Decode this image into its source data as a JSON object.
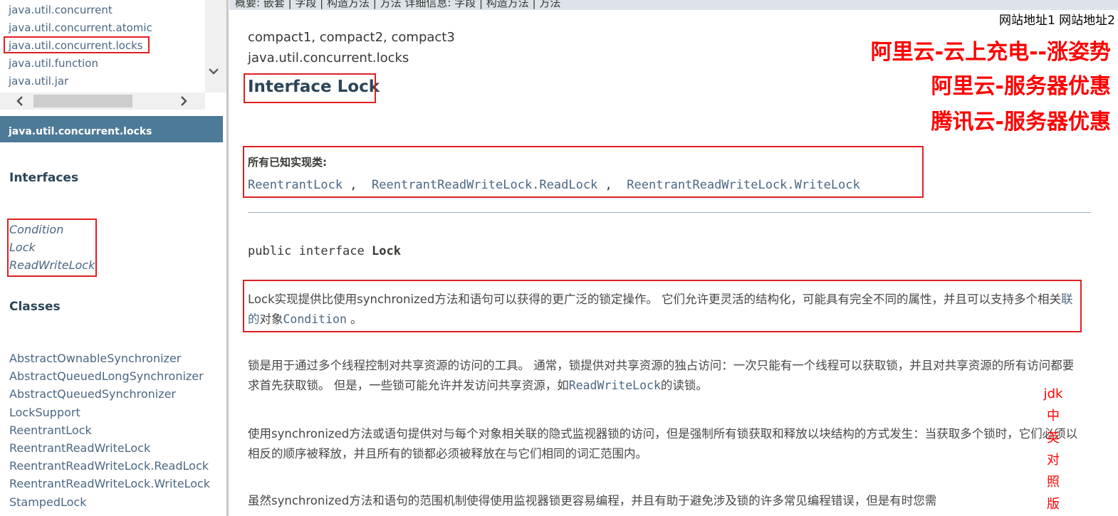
{
  "package_frame": {
    "packages": [
      "java.util.concurrent",
      "java.util.concurrent.atomic",
      "java.util.concurrent.locks",
      "java.util.function",
      "java.util.jar"
    ]
  },
  "class_frame": {
    "package_name": "java.util.concurrent.locks",
    "interfaces_title": "Interfaces",
    "interfaces": [
      "Condition",
      "Lock",
      "ReadWriteLock"
    ],
    "classes_title": "Classes",
    "classes": [
      "AbstractOwnableSynchronizer",
      "AbstractQueuedLongSynchronizer",
      "AbstractQueuedSynchronizer",
      "LockSupport",
      "ReentrantLock",
      "ReentrantReadWriteLock",
      "ReentrantReadWriteLock.ReadLock",
      "ReentrantReadWriteLock.WriteLock",
      "StampedLock"
    ]
  },
  "top_nav": {
    "text": "概要:   嵌套 | 字段 | 构造方法 | 方法       详细信息:   字段 | 构造方法 | 方法"
  },
  "content": {
    "profiles": "compact1, compact2, compact3",
    "package": "java.util.concurrent.locks",
    "title": "Interface Lock",
    "known_impl_label": "所有已知实现类:",
    "known_impl": [
      "ReentrantLock",
      "ReentrantReadWriteLock.ReadLock",
      "ReentrantReadWriteLock.WriteLock"
    ],
    "known_impl_sep": " ,  ",
    "sig_prefix": "public interface ",
    "sig_name": "Lock",
    "p1_a": "Lock实现提供比使用synchronized方法和语句可以获得的更广泛的锁定操作。 它们允许更灵活的结构化，可能具有完全不同的属性，并且可以支持多个相关",
    "p1_link": "联的",
    "p1_b": "对象",
    "p1_code": "Condition",
    "p1_end": " 。",
    "p2_a": "锁是用于通过多个线程控制对共享资源的访问的工具。 通常，锁提供对共享资源的独占访问：一次只能有一个线程可以获取锁，并且对共享资源的所有访问都要求首先获取锁。 但是，一些锁可能允许并发访问共享资源，如",
    "p2_code": "ReadWriteLock",
    "p2_b": "的读锁。",
    "p3": "使用synchronized方法或语句提供对与每个对象相关联的隐式监视器锁的访问，但是强制所有锁获取和释放以块结构的方式发生：当获取多个锁时，它们必须以相反的顺序被释放，并且所有的锁都必须被释放在与它们相同的词汇范围内。",
    "p4": "虽然synchronized方法和语句的范围机制使得使用监视器锁更容易编程，并且有助于避免涉及锁的许多常见编程错误，但是有时您需"
  },
  "ads": {
    "site_links": "网站地址1 网站地址2",
    "ad1": "阿里云-云上充电--涨姿势",
    "ad2": "阿里云-服务器优惠",
    "ad3": "腾讯云-服务器优惠",
    "jdk_label": [
      "jdk",
      "中",
      "英",
      "对",
      "照",
      "版"
    ]
  },
  "colors": {
    "banner": "#4d7a97",
    "link": "#4a6782",
    "highlight_box": "#e02020",
    "ad_text": "#ff0000"
  }
}
